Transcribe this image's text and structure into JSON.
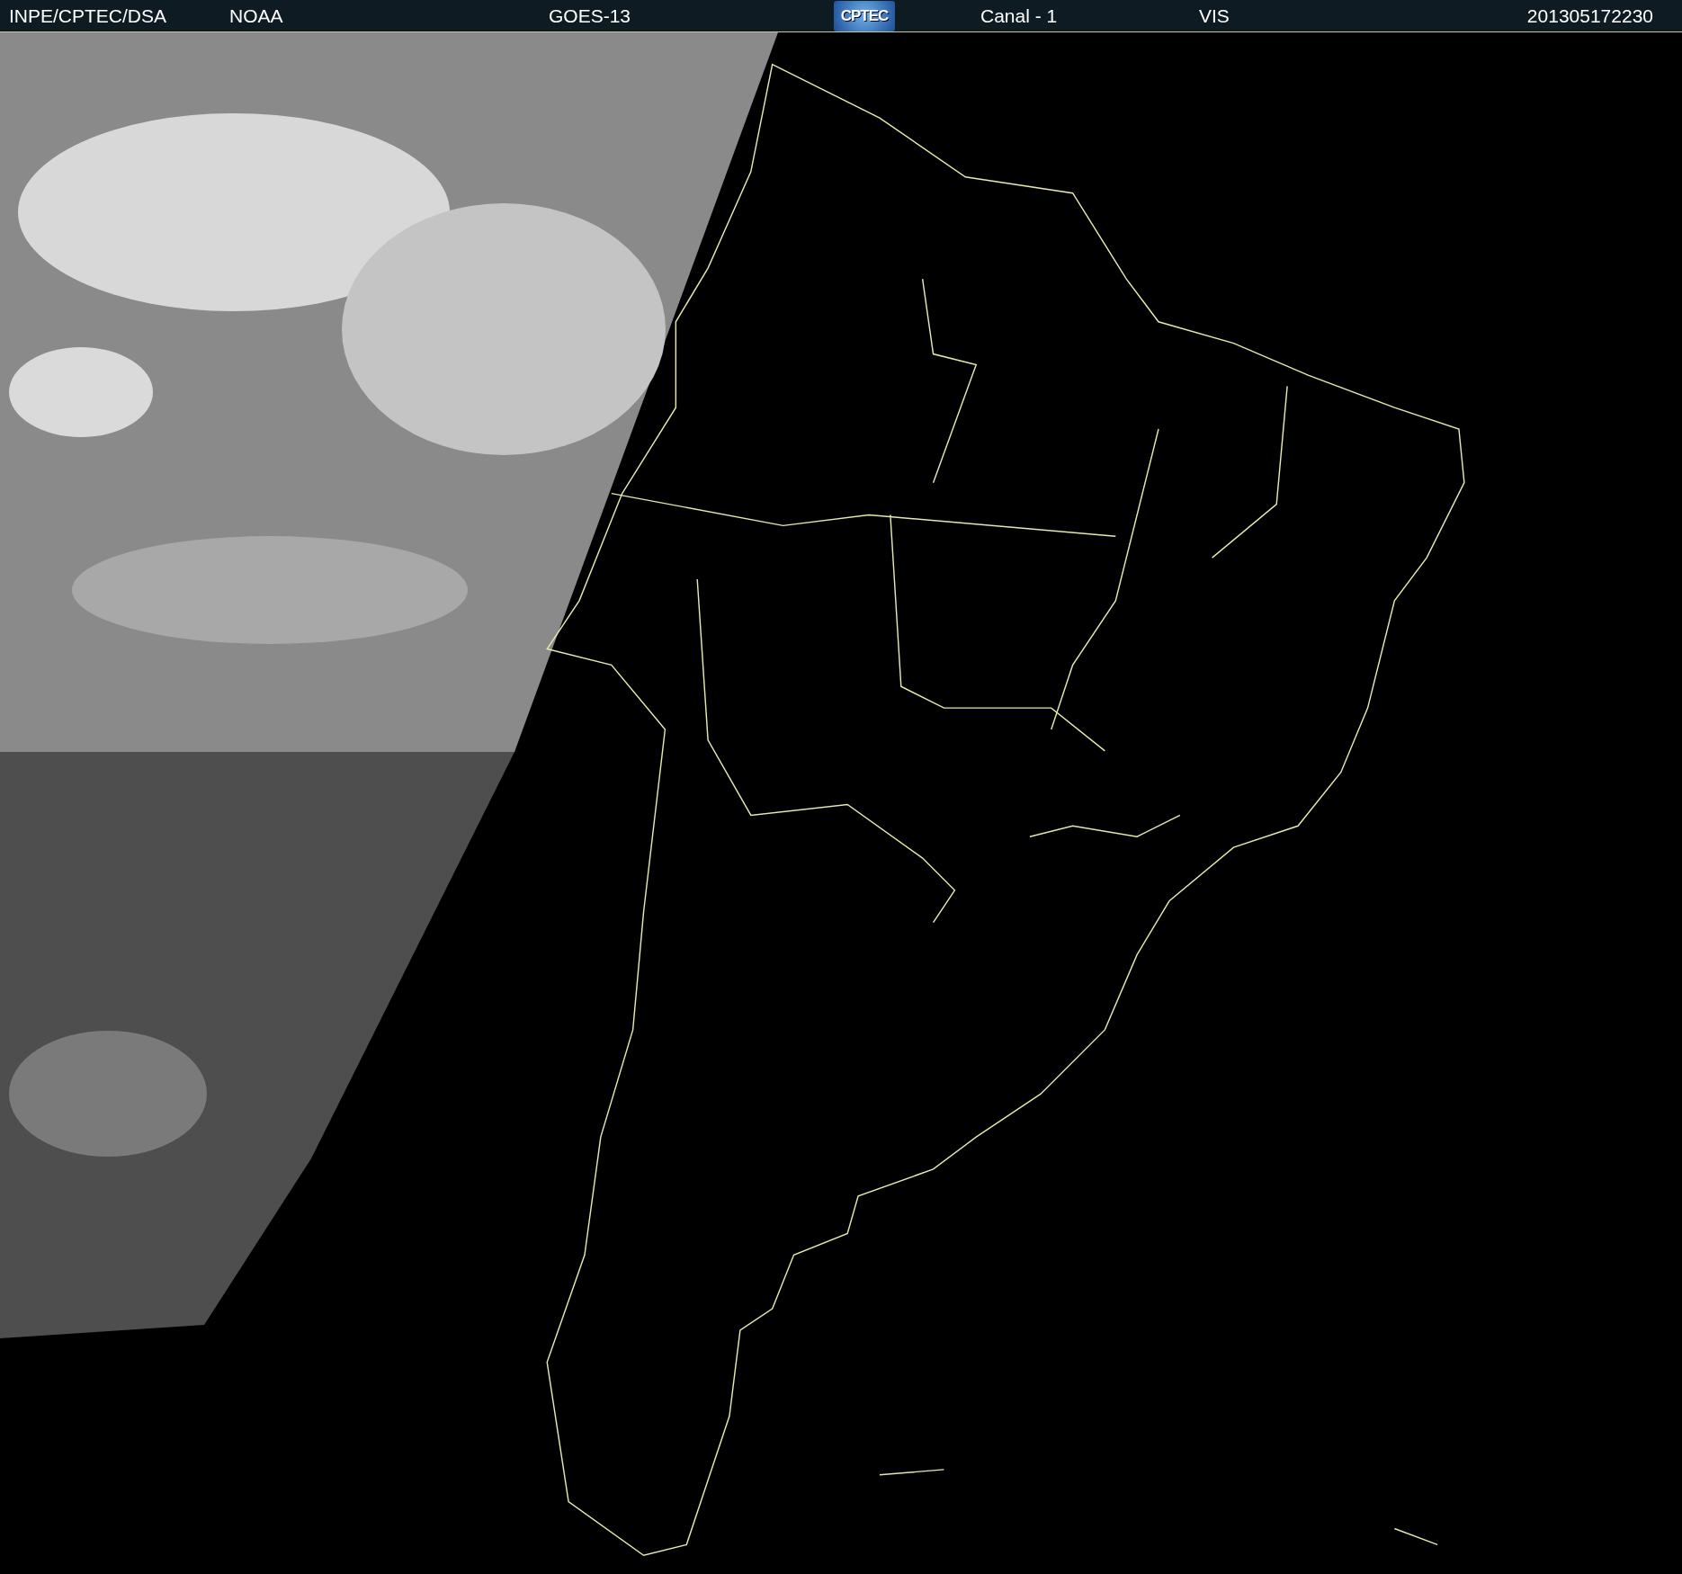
{
  "header": {
    "source": "INPE/CPTEC/DSA",
    "agency": "NOAA",
    "satellite": "GOES-13",
    "logo": "CPTEC",
    "channel": "Canal - 1",
    "band": "VIS",
    "timestamp": "201305172230"
  }
}
